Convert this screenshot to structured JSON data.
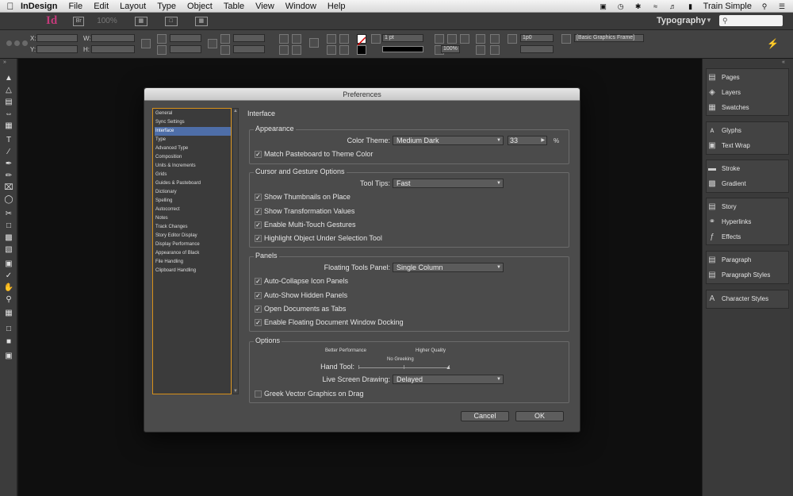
{
  "menubar": {
    "app_name": "InDesign",
    "menus": [
      "File",
      "Edit",
      "Layout",
      "Type",
      "Object",
      "Table",
      "View",
      "Window",
      "Help"
    ],
    "user": "Train Simple"
  },
  "appbar": {
    "logo": "Id",
    "bridge": "Br",
    "zoom": "100%",
    "workspace": "Typography"
  },
  "control": {
    "x_label": "X:",
    "y_label": "Y:",
    "w_label": "W:",
    "h_label": "H:",
    "stroke_weight": "1 pt",
    "opacity": "100%",
    "spacing": "1p0",
    "object_style": "[Basic Graphics Frame]"
  },
  "right_panels": {
    "groups": [
      [
        {
          "label": "Pages",
          "icon": "pages-icon"
        },
        {
          "label": "Layers",
          "icon": "layers-icon"
        },
        {
          "label": "Swatches",
          "icon": "swatches-icon"
        }
      ],
      [
        {
          "label": "Glyphs",
          "icon": "glyphs-icon"
        },
        {
          "label": "Text Wrap",
          "icon": "text-wrap-icon"
        }
      ],
      [
        {
          "label": "Stroke",
          "icon": "stroke-icon"
        },
        {
          "label": "Gradient",
          "icon": "gradient-icon"
        }
      ],
      [
        {
          "label": "Story",
          "icon": "story-icon"
        },
        {
          "label": "Hyperlinks",
          "icon": "hyperlinks-icon"
        },
        {
          "label": "Effects",
          "icon": "effects-icon"
        }
      ],
      [
        {
          "label": "Paragraph",
          "icon": "paragraph-icon"
        },
        {
          "label": "Paragraph Styles",
          "icon": "paragraph-styles-icon"
        }
      ],
      [
        {
          "label": "Character Styles",
          "icon": "character-styles-icon"
        }
      ]
    ]
  },
  "dialog": {
    "title": "Preferences",
    "categories": [
      "General",
      "Sync Settings",
      "Interface",
      "Type",
      "Advanced Type",
      "Composition",
      "Units & Increments",
      "Grids",
      "Guides & Pasteboard",
      "Dictionary",
      "Spelling",
      "Autocorrect",
      "Notes",
      "Track Changes",
      "Story Editor Display",
      "Display Performance",
      "Appearance of Black",
      "File Handling",
      "Clipboard Handling"
    ],
    "selected_category": "Interface",
    "section_title": "Interface",
    "appearance": {
      "title": "Appearance",
      "color_theme_label": "Color Theme:",
      "color_theme_value": "Medium Dark",
      "brightness_value": "33",
      "brightness_unit": "%",
      "match_pasteboard": "Match Pasteboard to Theme Color"
    },
    "cursor": {
      "title": "Cursor and Gesture Options",
      "tool_tips_label": "Tool Tips:",
      "tool_tips_value": "Fast",
      "checks": [
        "Show Thumbnails on Place",
        "Show Transformation Values",
        "Enable Multi-Touch Gestures",
        "Highlight Object Under Selection Tool"
      ]
    },
    "panels": {
      "title": "Panels",
      "floating_label": "Floating Tools Panel:",
      "floating_value": "Single Column",
      "checks": [
        "Auto-Collapse Icon Panels",
        "Auto-Show Hidden Panels",
        "Open Documents as Tabs",
        "Enable Floating Document Window Docking"
      ]
    },
    "options": {
      "title": "Options",
      "better_performance": "Better Performance",
      "higher_quality": "Higher Quality",
      "no_greeking": "No Greeking",
      "hand_tool_label": "Hand Tool:",
      "live_screen_label": "Live Screen Drawing:",
      "live_screen_value": "Delayed",
      "greek_vector": "Greek Vector Graphics on Drag"
    },
    "cancel_label": "Cancel",
    "ok_label": "OK"
  }
}
